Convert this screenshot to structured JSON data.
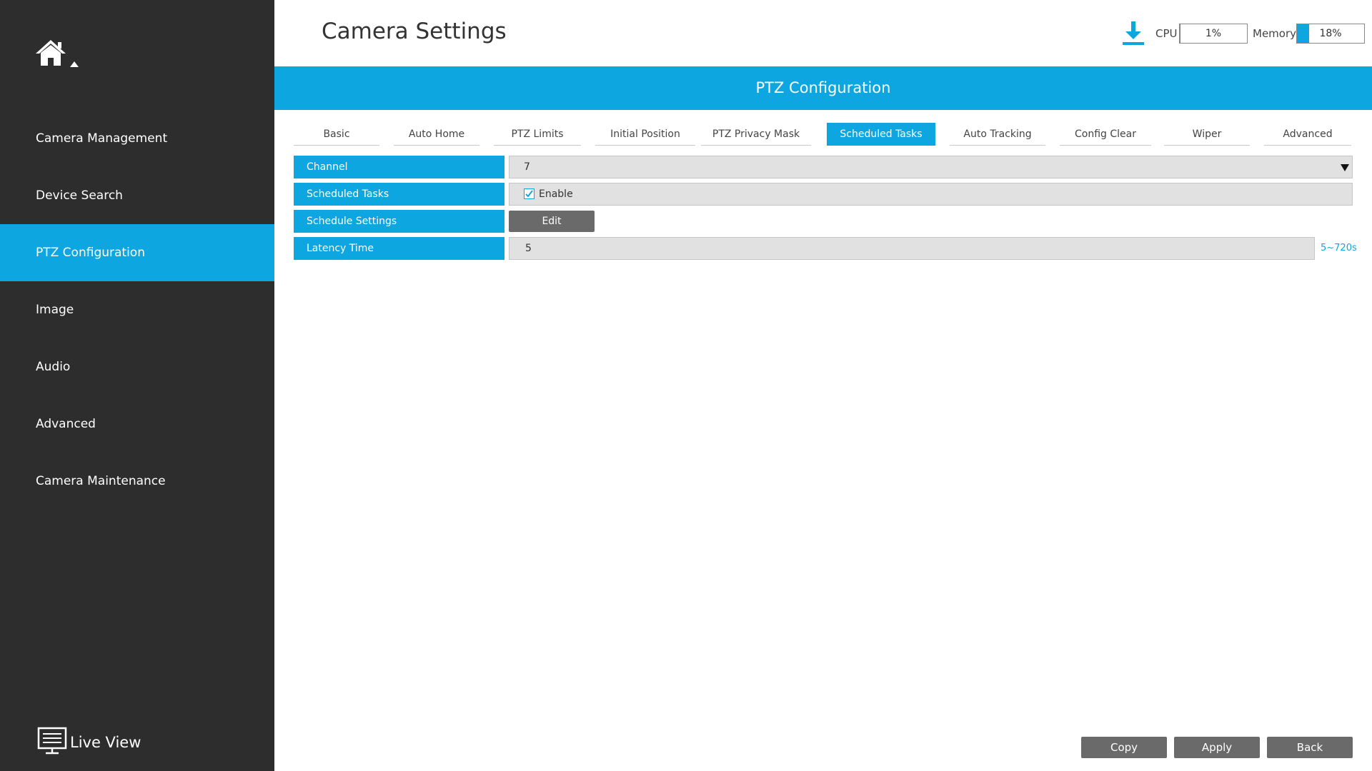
{
  "sidebar": {
    "items": [
      {
        "label": "Camera Management"
      },
      {
        "label": "Device Search"
      },
      {
        "label": "PTZ Configuration"
      },
      {
        "label": "Image"
      },
      {
        "label": "Audio"
      },
      {
        "label": "Advanced"
      },
      {
        "label": "Camera Maintenance"
      }
    ],
    "active_index": 2,
    "live_view": "Live View"
  },
  "header": {
    "title": "Camera Settings",
    "cpu_label": "CPU",
    "cpu_value": "1%",
    "cpu_level": 0.01,
    "memory_label": "Memory",
    "memory_value": "18%",
    "memory_level": 0.18
  },
  "banner": {
    "title": "PTZ Configuration"
  },
  "tabs": [
    {
      "label": "Basic"
    },
    {
      "label": "Auto Home"
    },
    {
      "label": "PTZ Limits"
    },
    {
      "label": "Initial Position"
    },
    {
      "label": "PTZ Privacy Mask"
    },
    {
      "label": "Scheduled Tasks"
    },
    {
      "label": "Auto Tracking"
    },
    {
      "label": "Config Clear"
    },
    {
      "label": "Wiper"
    },
    {
      "label": "Advanced"
    }
  ],
  "active_tab": "Scheduled Tasks",
  "form": {
    "channel_label": "Channel",
    "channel_value": "7",
    "scheduled_tasks_label": "Scheduled Tasks",
    "enable_label": "Enable",
    "enable_checked": true,
    "schedule_settings_label": "Schedule Settings",
    "edit_label": "Edit",
    "latency_label": "Latency Time",
    "latency_value": "5",
    "latency_range": "5~720s"
  },
  "footer": {
    "copy": "Copy",
    "apply": "Apply",
    "back": "Back"
  },
  "colors": {
    "accent": "#0da6e0",
    "sidebar_bg": "#2d2d2d",
    "button_gray": "#6a6a6a"
  }
}
